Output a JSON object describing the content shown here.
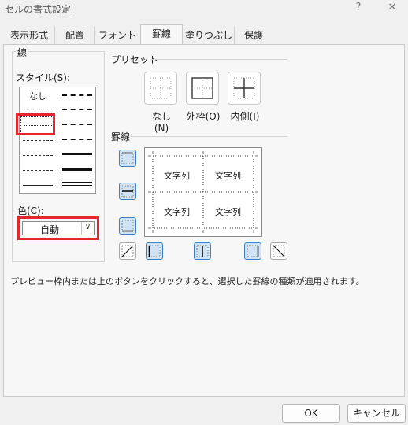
{
  "window": {
    "title": "セルの書式設定",
    "help": "?",
    "close": "✕"
  },
  "tabs": [
    {
      "label": "表示形式"
    },
    {
      "label": "配置"
    },
    {
      "label": "フォント"
    },
    {
      "label": "罫線",
      "active": true
    },
    {
      "label": "塗りつぶし"
    },
    {
      "label": "保護"
    }
  ],
  "line": {
    "group_label": "線",
    "style_label": "スタイル(S):",
    "style_none": "なし",
    "selected_style": "dotted",
    "color_label": "色(C):",
    "color_value": "自動"
  },
  "preset": {
    "label": "プリセット",
    "buttons": [
      {
        "label": "なし(N)",
        "underline": "N",
        "name": "none"
      },
      {
        "label": "外枠(O)",
        "underline": "O",
        "name": "outline"
      },
      {
        "label": "内側(I)",
        "underline": "I",
        "name": "inside"
      }
    ]
  },
  "border": {
    "label": "罫線",
    "preview_text": "文字列"
  },
  "hint": "プレビュー枠内または上のボタンをクリックすると、選択した罫線の種類が適用されます。",
  "buttons": {
    "ok": "OK",
    "cancel": "キャンセル"
  },
  "colors": {
    "highlight_red": "#e5262c",
    "active_border_button": "#cfe3f5",
    "accent_blue": "#3a80c0"
  }
}
